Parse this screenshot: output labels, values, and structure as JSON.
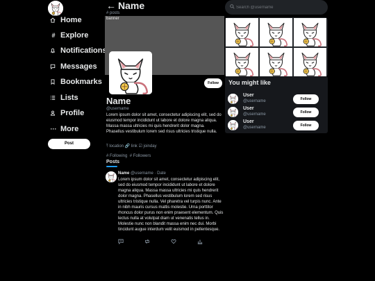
{
  "nav": {
    "items": [
      {
        "icon": "home-icon",
        "label": "Home"
      },
      {
        "icon": "hashtag-icon",
        "label": "Explore"
      },
      {
        "icon": "bell-icon",
        "label": "Notifications"
      },
      {
        "icon": "message-icon",
        "label": "Messages"
      },
      {
        "icon": "bookmark-icon",
        "label": "Bookmarks"
      },
      {
        "icon": "list-icon",
        "label": "Lists"
      },
      {
        "icon": "person-icon",
        "label": "Profile"
      },
      {
        "icon": "more-icon",
        "label": "More"
      }
    ],
    "post_label": "Post"
  },
  "profile": {
    "back_arrow": "←",
    "title": "Name",
    "posts_count": "# posts",
    "banner_label": "banner",
    "follow_label": "Follow",
    "name": "Name",
    "username": "@username",
    "bio": "Lorem ipsum dolor sit amet, consectetur adipiscing elit, sed do eiusmod tempor incididunt ut labore et dolore magna aliqua. Massa massa ultricies mi quis hendrerit dolor magna. Phasellus vestibulum lorem sed risus ultricies tristique nulla.",
    "meta": "⤒ location 🔗 link ☑ joinday",
    "following": "# Following",
    "followers": "# Followers",
    "tab": "Posts"
  },
  "post": {
    "name": "Name",
    "username": "@username",
    "date": "· Date",
    "text": "Lorem ipsum dolor sit amet, consectetur adipiscing elit, sed do eiusmod tempor incididunt ut labore et dolore magna aliqua. Massa massa ultricies mi quis hendrerit dolor magna. Phasellus vestibulum lorem sed risus ultricies tristique nulla. Vel pharetra vel turpis nunc. Ante in nibh mauris cursus mattis molestie. Urna porttitor rhoncus dolor purus non enim praesent elementum. Quis lectus nulla at volutpat diam ut venenatis tellus in. Molestie nunc non blandit massa enim nec dui. Morbi tincidunt augue interdum velit euismod in pellentesque."
  },
  "search": {
    "placeholder": "Search @username"
  },
  "suggestions": {
    "title": "You might like",
    "users": [
      {
        "name": "User",
        "username": "@username",
        "button": "Follow"
      },
      {
        "name": "User",
        "username": "@username",
        "button": "Follow"
      },
      {
        "name": "User",
        "username": "@username",
        "button": "Follow"
      }
    ]
  },
  "colors": {
    "background": "#000000",
    "accent": "#1d9bf0",
    "banner": "#555555",
    "panel": "#16181c"
  }
}
